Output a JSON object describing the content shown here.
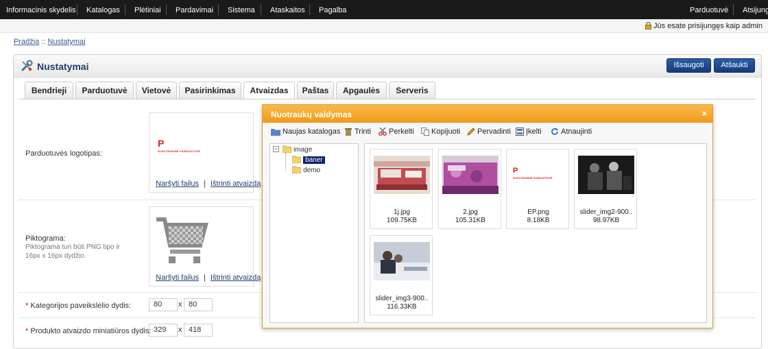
{
  "topnav": {
    "items": [
      "Informacinis skydelis",
      "Katalogas",
      "Plėtiniai",
      "Pardavimai",
      "Sistema",
      "Ataskaitos",
      "Pagalba"
    ],
    "right_items": [
      "Parduotuvė",
      "Atsijungti"
    ]
  },
  "login_text": "Jūs esate prisijungęs kaip admin",
  "breadcrumb": {
    "home": "Pradžia",
    "sep": "::",
    "current": "Nustatymai"
  },
  "panel": {
    "title": "Nustatymai",
    "save_label": "Išsaugoti",
    "cancel_label": "Atšaukti"
  },
  "tabs": [
    "Bendrieji",
    "Parduotuvė",
    "Vietovė",
    "Pasirinkimas",
    "Atvaizdas",
    "Paštas",
    "Apgaulės",
    "Serveris"
  ],
  "active_tab": "Atvaizdas",
  "form": {
    "logo_label": "Parduotuvės logotipas:",
    "icon_label": "Piktograma:",
    "icon_hint": "Piktograma turi būti PNG tipo ir 16px x 16px dydžio.",
    "browse": "Naršyti failus",
    "delete": "Ištrinti atvaizdą",
    "divider": "|",
    "category_label": "Kategorijos paveikslėlio dydis:",
    "category_w": "80",
    "category_h": "80",
    "product_label": "Produkto atvaizdo miniatiūros dydis:",
    "product_w": "329",
    "product_h": "418",
    "times": "x",
    "required_mark": "*"
  },
  "logo_text": {
    "letter": "P",
    "tagline": "ELEKTRONINĖ PARDUOTUVĖ"
  },
  "dialog": {
    "title": "Nuotraukų valdymas",
    "close": "×",
    "toolbar": [
      "Naujas katalogas",
      "Trinti",
      "Perkelti",
      "Kopijuoti",
      "Pervadinti",
      "Įkelti",
      "Atnaujinti"
    ],
    "tree": {
      "root": "image",
      "children": [
        "baner",
        "demo"
      ],
      "selected": "baner",
      "collapse": "−"
    },
    "files": [
      {
        "name": "1j.jpg",
        "size": "109.75KB"
      },
      {
        "name": "2.jpg",
        "size": "105.31KB"
      },
      {
        "name": "EP.png",
        "size": "8.18KB"
      },
      {
        "name": "slider_img2-900..",
        "size": "98.97KB"
      },
      {
        "name": "slider_img3-900..",
        "size": "116.33KB"
      }
    ]
  },
  "colors": {
    "accent": "#f09a1a",
    "nav": "#1a1a1a",
    "button": "#1f4c8f",
    "title": "#1f3e6e",
    "logo_red": "#e11b22"
  }
}
